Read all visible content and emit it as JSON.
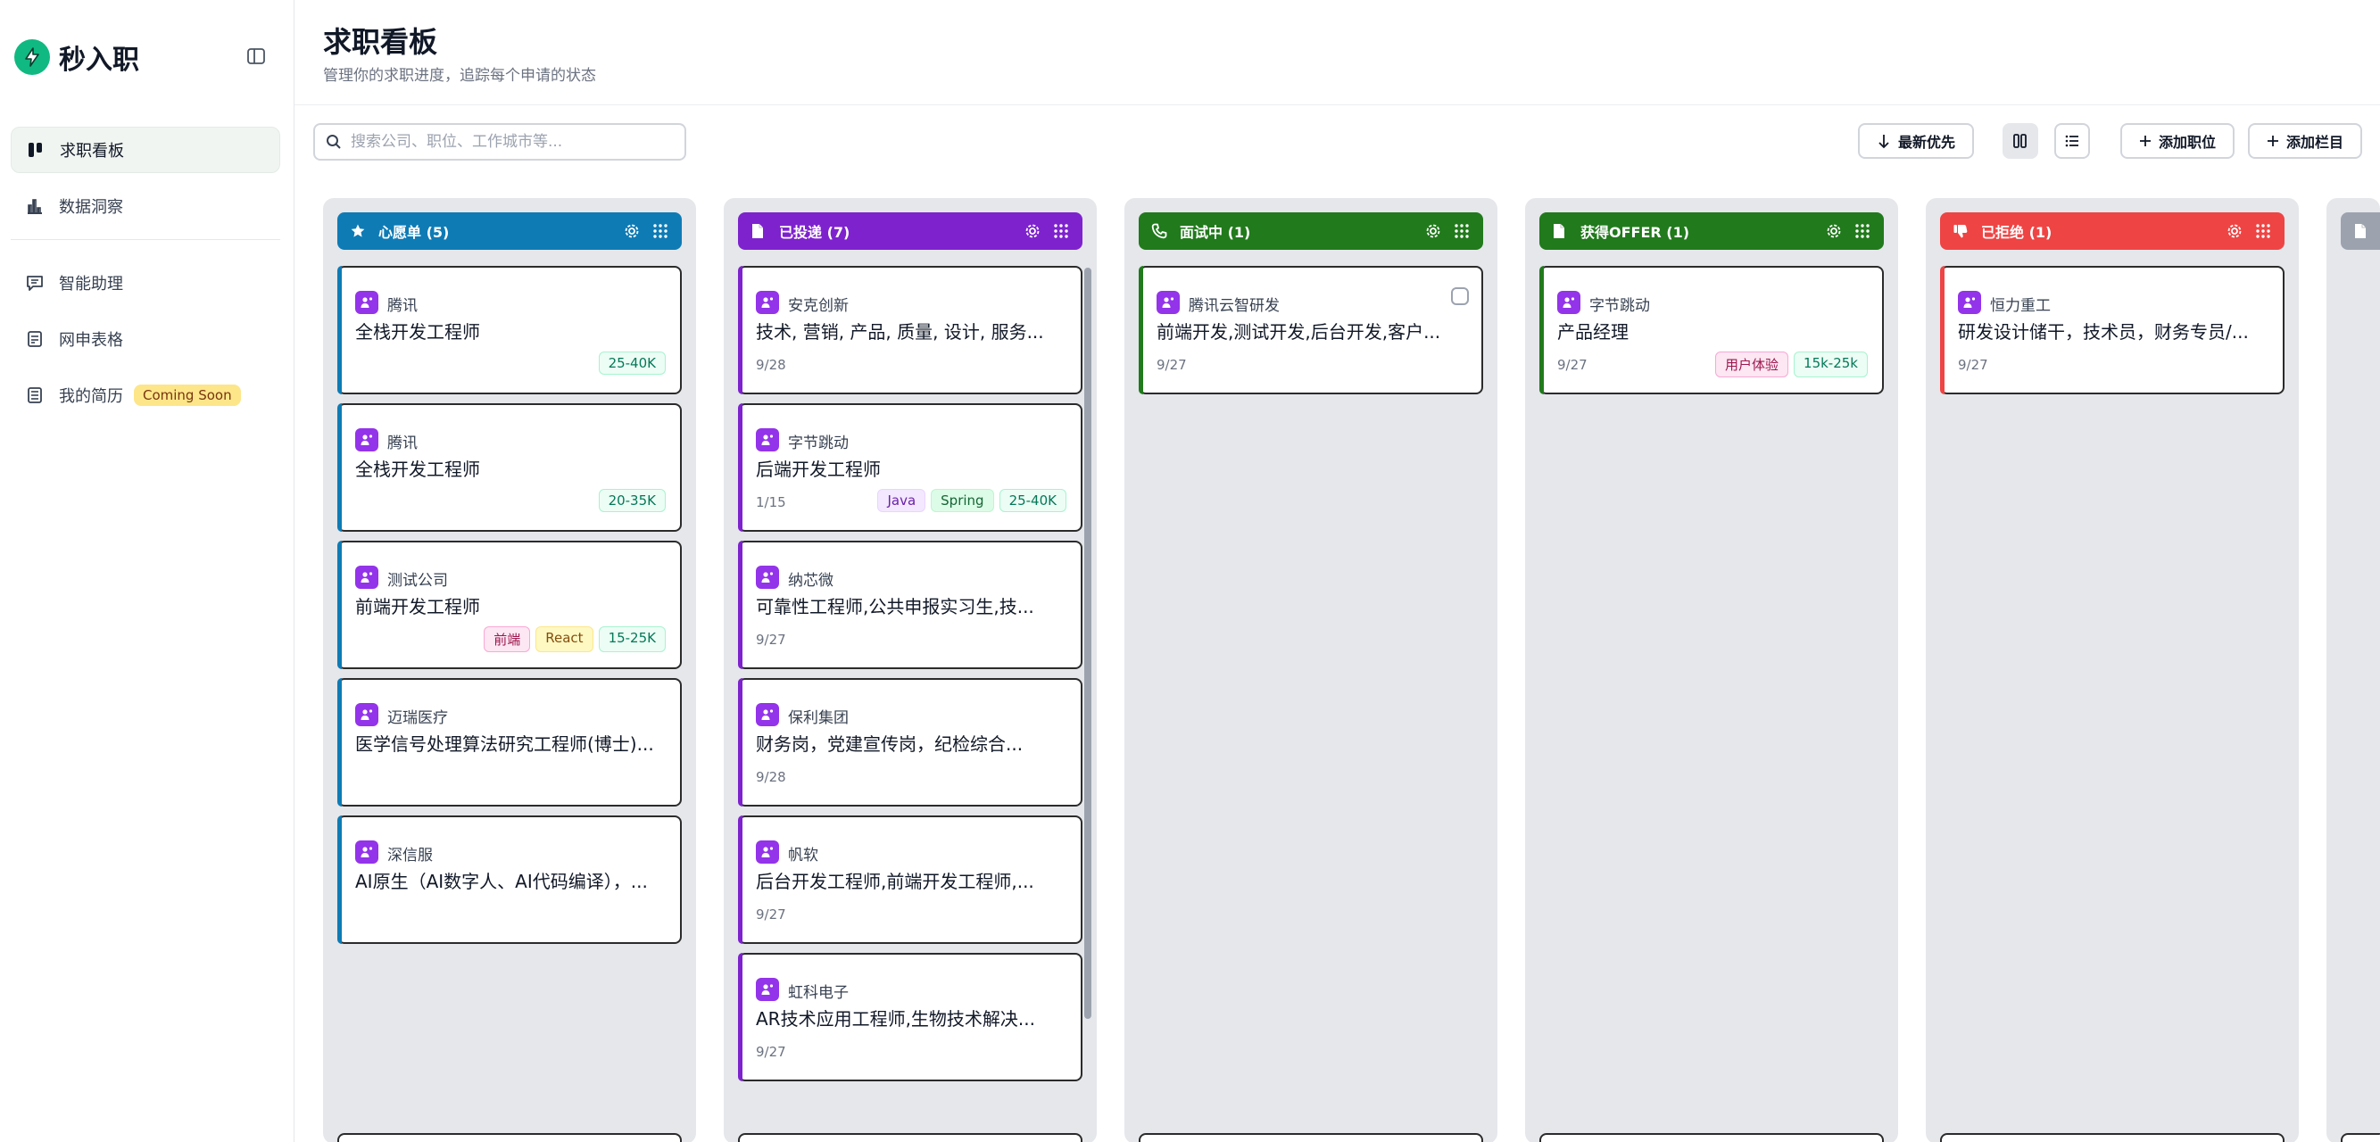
{
  "sidebar": {
    "brand": "秒入职",
    "items": [
      {
        "label": "求职看板",
        "icon": "kanban-icon",
        "active": true
      },
      {
        "label": "数据洞察",
        "icon": "bar-chart-icon",
        "active": false
      },
      {
        "label": "智能助理",
        "icon": "chat-icon",
        "active": false
      },
      {
        "label": "网申表格",
        "icon": "form-icon",
        "active": false
      },
      {
        "label": "我的简历",
        "icon": "resume-icon",
        "active": false,
        "badge": "Coming Soon"
      }
    ]
  },
  "header": {
    "title": "求职看板",
    "subtitle": "管理你的求职进度，追踪每个申请的状态"
  },
  "toolbar": {
    "search_placeholder": "搜索公司、职位、工作城市等...",
    "sort_label": "最新优先",
    "add_job_label": "添加职位",
    "add_column_label": "添加栏目"
  },
  "columns": [
    {
      "name": "心愿单 (5)",
      "color": "#0e7bb5",
      "icon": "star-icon",
      "cards": [
        {
          "company": "腾讯",
          "title": "全栈开发工程师",
          "date": "",
          "tags": [
            {
              "text": "25-40K",
              "style": "salary"
            }
          ]
        },
        {
          "company": "腾讯",
          "title": "全栈开发工程师",
          "date": "",
          "tags": [
            {
              "text": "20-35K",
              "style": "salary"
            }
          ]
        },
        {
          "company": "测试公司",
          "title": "前端开发工程师",
          "date": "",
          "tags": [
            {
              "text": "前端",
              "style": "pink"
            },
            {
              "text": "React",
              "style": "yellow"
            },
            {
              "text": "15-25K",
              "style": "salary"
            }
          ]
        },
        {
          "company": "迈瑞医疗",
          "title": "医学信号处理算法研究工程师(博士)...",
          "date": "",
          "tags": []
        },
        {
          "company": "深信服",
          "title": "AI原生（AI数字人、AI代码编译），...",
          "date": "",
          "tags": []
        }
      ]
    },
    {
      "name": "已投递 (7)",
      "color": "#7e22ce",
      "icon": "document-icon",
      "cards": [
        {
          "company": "安克创新",
          "title": "技术, 营销, 产品, 质量, 设计, 服务...",
          "date": "9/28",
          "tags": []
        },
        {
          "company": "字节跳动",
          "title": "后端开发工程师",
          "date": "1/15",
          "tags": [
            {
              "text": "Java",
              "style": "purple"
            },
            {
              "text": "Spring",
              "style": "green"
            },
            {
              "text": "25-40K",
              "style": "salary"
            }
          ]
        },
        {
          "company": "纳芯微",
          "title": "可靠性工程师,公共申报实习生,技...",
          "date": "9/27",
          "tags": []
        },
        {
          "company": "保利集团",
          "title": "财务岗，党建宣传岗，纪检综合...",
          "date": "9/28",
          "tags": []
        },
        {
          "company": "帆软",
          "title": "后台开发工程师,前端开发工程师,...",
          "date": "9/27",
          "tags": []
        },
        {
          "company": "虹科电子",
          "title": "AR技术应用工程师,生物技术解决...",
          "date": "9/27",
          "tags": []
        }
      ]
    },
    {
      "name": "面试中 (1)",
      "color": "#217a1c",
      "icon": "phone-icon",
      "cards": [
        {
          "company": "腾讯云智研发",
          "title": "前端开发,测试开发,后台开发,客户...",
          "date": "9/27",
          "tags": [],
          "checkbox": true
        }
      ]
    },
    {
      "name": "获得OFFER (1)",
      "color": "#217a1c",
      "icon": "document-icon",
      "cards": [
        {
          "company": "字节跳动",
          "title": "产品经理",
          "date": "9/27",
          "tags": [
            {
              "text": "用户体验",
              "style": "pink"
            },
            {
              "text": "15k-25k",
              "style": "salary"
            }
          ]
        }
      ]
    },
    {
      "name": "已拒绝 (1)",
      "color": "#ef4444",
      "icon": "thumbs-down-icon",
      "cards": [
        {
          "company": "恒力重工",
          "title": "研发设计储干，技术员，财务专员/...",
          "date": "9/27",
          "tags": []
        }
      ]
    }
  ]
}
